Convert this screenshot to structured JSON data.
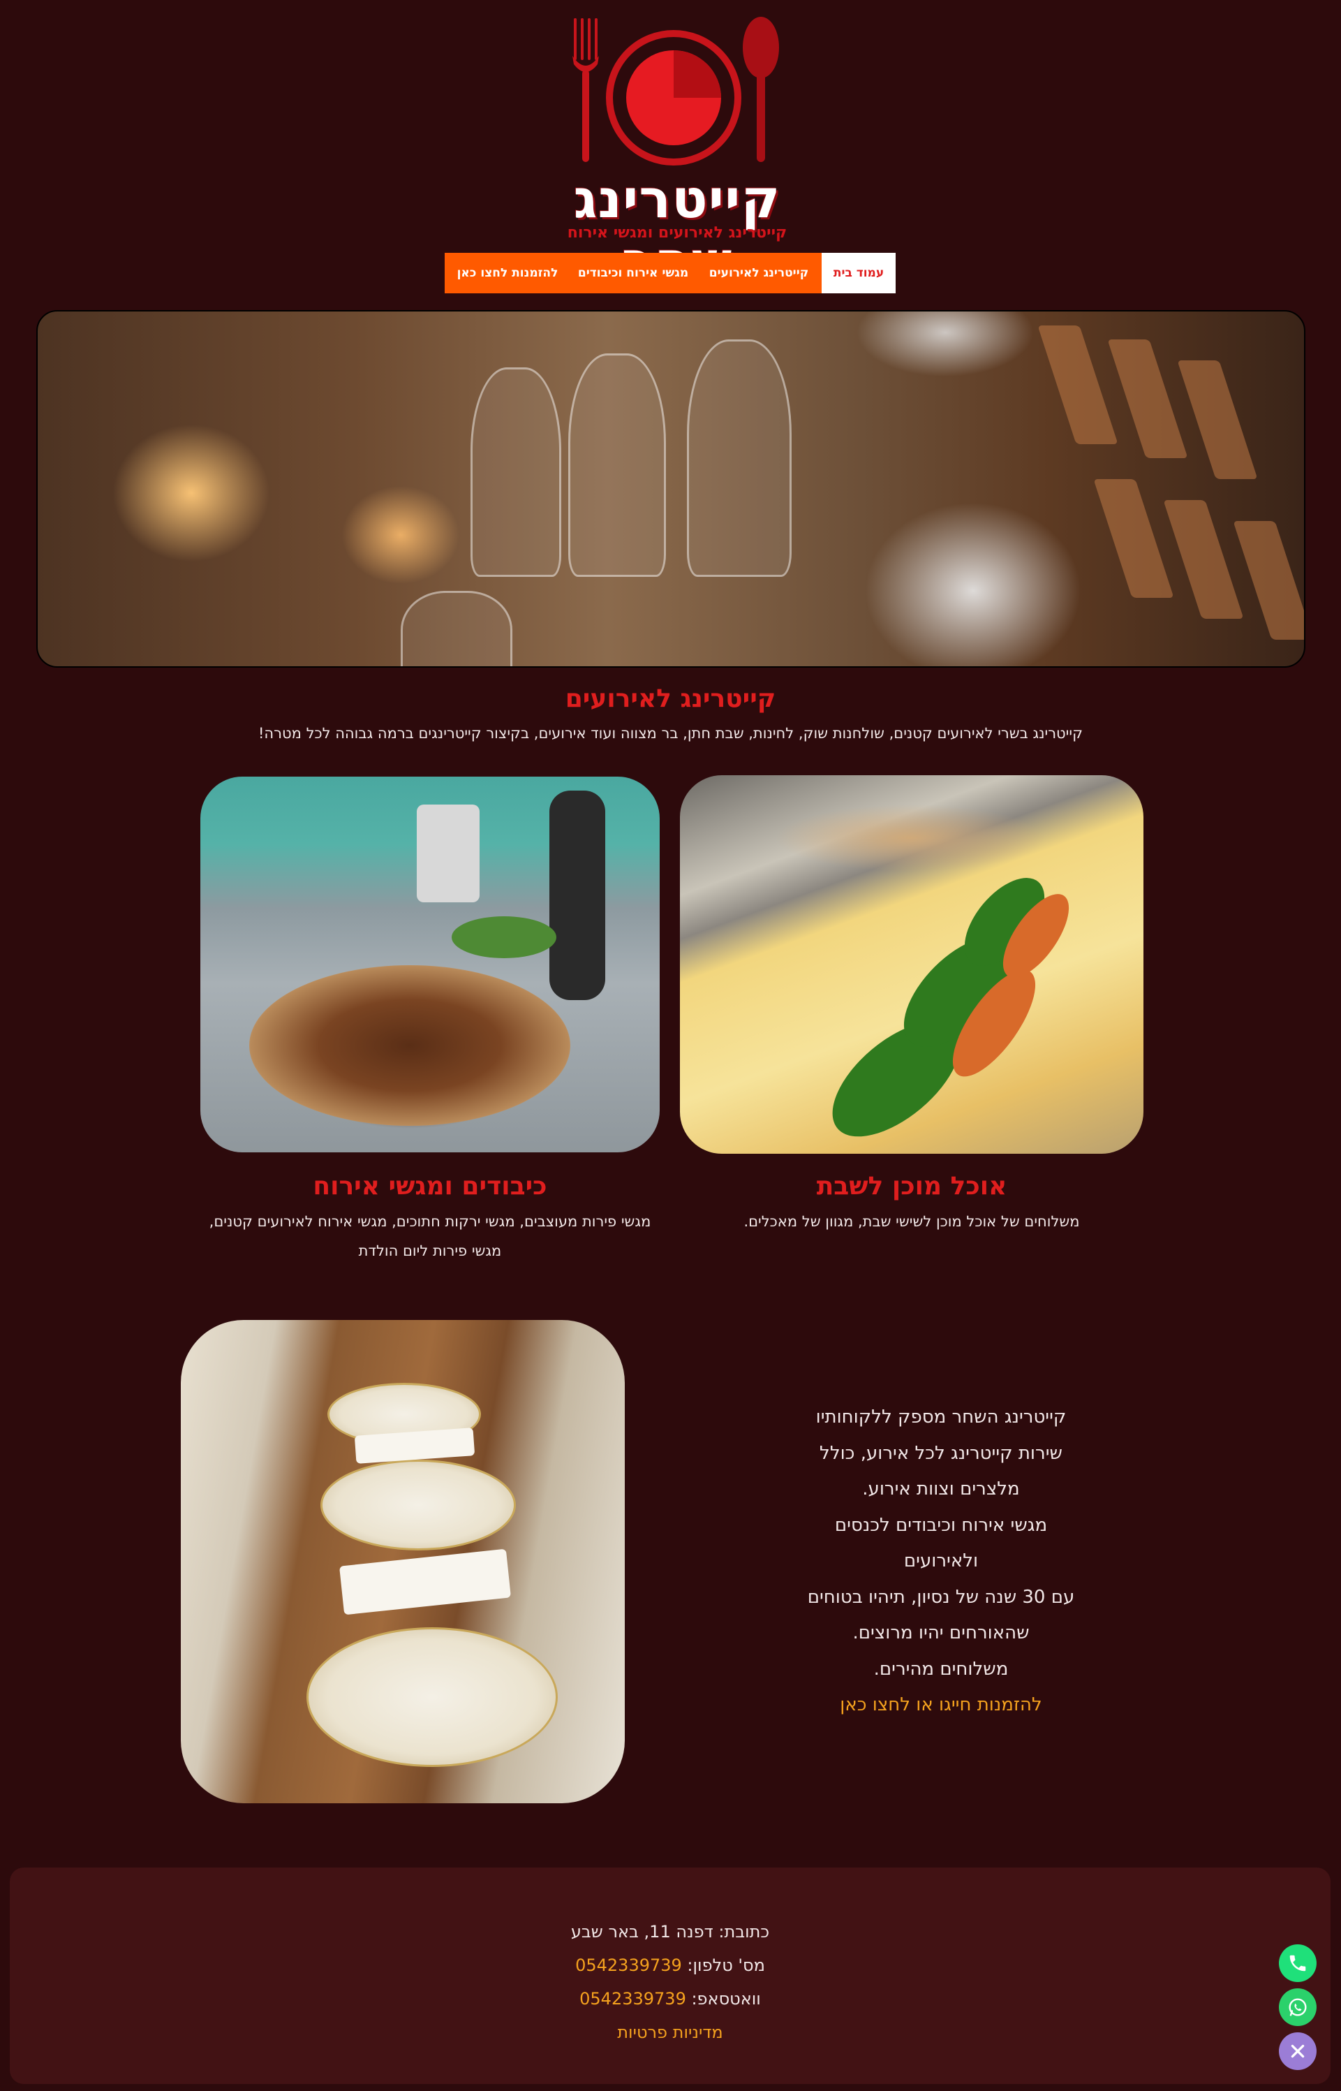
{
  "logo": {
    "title": "קייטרינג שחר",
    "subtitle": "קייטרינג לאירועים ומגשי אירוח"
  },
  "nav": {
    "home": "עמוד בית",
    "events": "קייטרינג לאירועים",
    "hosting": "מגשי אירוח וכיבודים",
    "order": "להזמנות לחצו כאן"
  },
  "section_events": {
    "title": "קייטרינג לאירועים",
    "description": "קייטרינג בשרי לאירועים קטנים, שולחנות שוק, לחינות, שבת חתן, בר מצווה ועוד אירועים, בקיצור קייטרינגים ברמה גבוהה לכל מטרה!"
  },
  "cards": {
    "shabbat": {
      "title": "אוכל מוכן לשבת",
      "description": "משלוחים של אוכל מוכן לשישי שבת, מגוון של מאכלים."
    },
    "hosting": {
      "title": "כיבודים ומגשי אירוח",
      "description_line1": "מגשי פירות מעוצבים, מגשי ירקות חתוכים, מגשי אירוח לאירועים קטנים,",
      "description_line2": "מגשי פירות ליום הולדת"
    }
  },
  "about": {
    "line1": "קייטרינג השחר מספק ללקוחותיו",
    "line2": "שירות קייטרינג לכל אירוע, כולל",
    "line3": "מלצרים וצוות אירוע.",
    "line4": "מגשי אירוח וכיבודים לכנסים",
    "line5": "ולאירועים",
    "line6": "עם 30 שנה של נסיון, תיהיו בטוחים",
    "line7": "שהאורחים יהיו מרוצים.",
    "line8": "משלוחים מהירים.",
    "link": "להזמנות חייגו או לחצו כאן"
  },
  "footer": {
    "address": "כתובת: דפנה 11, באר שבע",
    "phone_label": "מס' טלפון: ",
    "phone_value": "0542339739",
    "whatsapp_label": "וואטסאפ: ",
    "whatsapp_value": "0542339739",
    "privacy": "מדיניות פרטיות"
  },
  "colors": {
    "background": "#2d0a0c",
    "accent_red": "#e01e1e",
    "nav_orange": "#ff5a00",
    "link_orange": "#f5a21e",
    "footer_bg": "#421214"
  },
  "icons": {
    "phone_fab": "phone-icon",
    "whatsapp_fab": "whatsapp-icon",
    "close_fab": "close-icon"
  }
}
